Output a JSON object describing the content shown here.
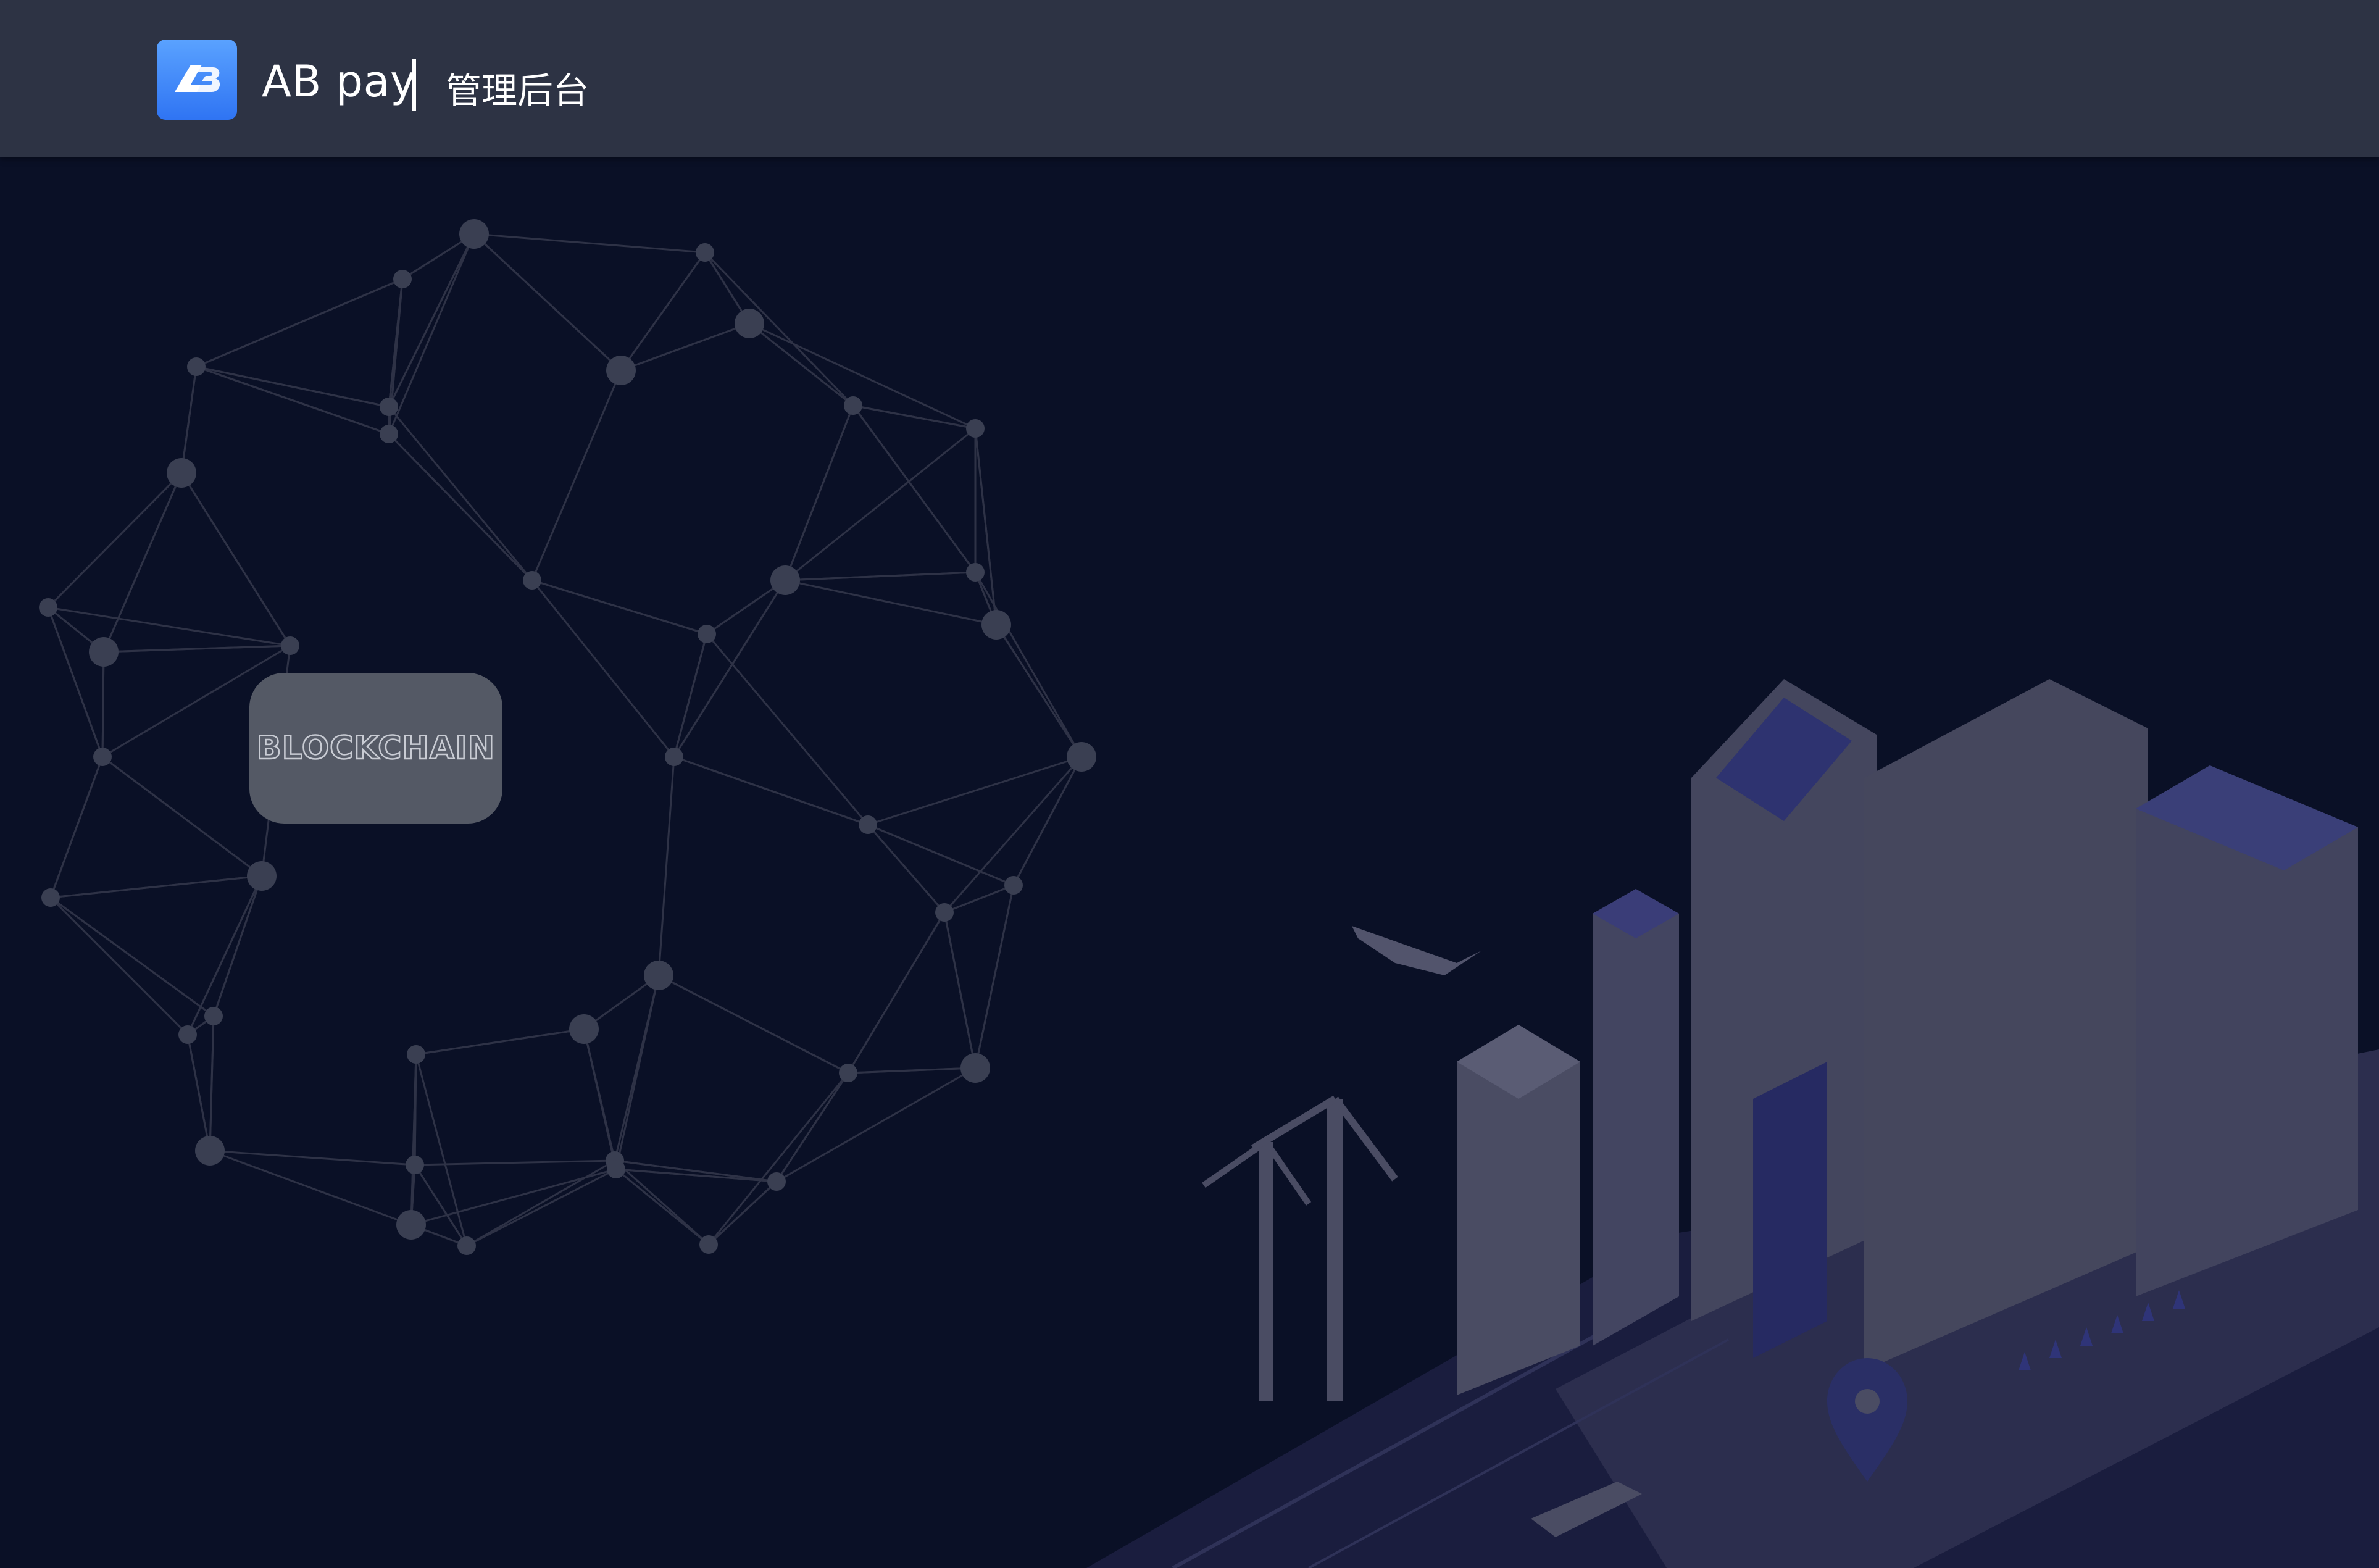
{
  "header": {
    "brand_name": "AB pay",
    "subtitle": "管理后台",
    "logo_icon": "ab-logo-icon"
  },
  "hero": {
    "badge_text": "BLOCKCHAIN"
  },
  "colors": {
    "header_bg": "#2d3344",
    "page_bg": "#0a1026",
    "logo_blue": "#3d86f8",
    "network_node": "#3a3f52",
    "city_building": "#3a3c56"
  }
}
